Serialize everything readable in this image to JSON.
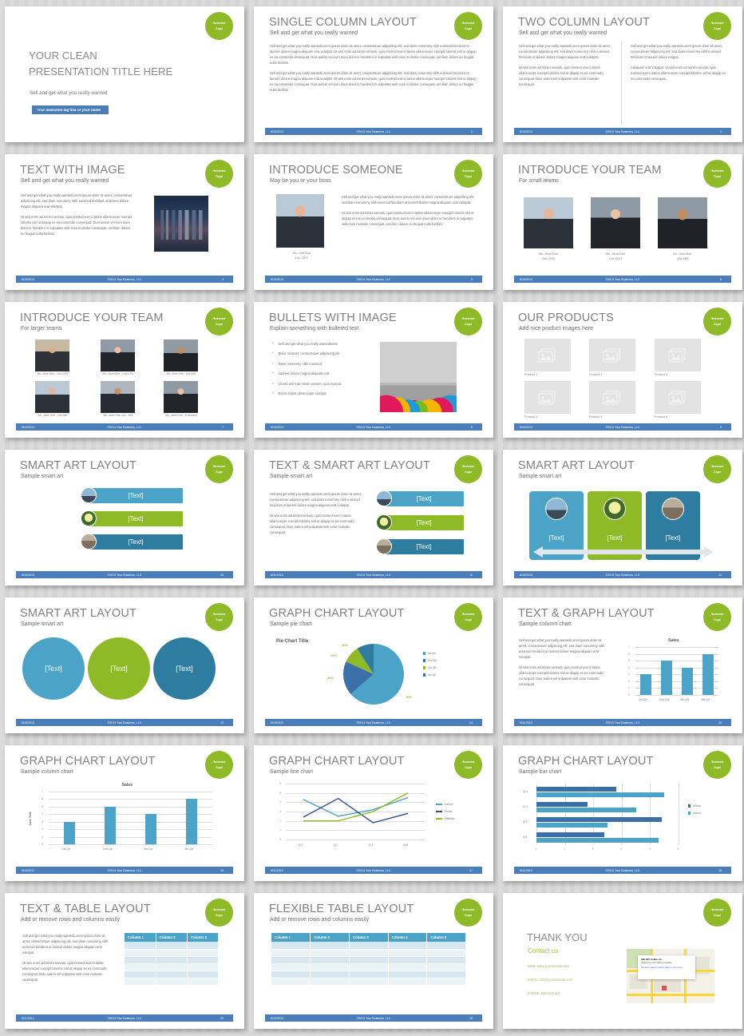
{
  "logo": {
    "line1": "Awesome",
    "line2": "Logo",
    "color": "#8fba28"
  },
  "footer_copy": "©2013 Your Business, LLC",
  "theme": {
    "blue": "#4a7ebb",
    "teal": "#4ba3c7",
    "green": "#8fba28",
    "dark_blue": "#2e6da4"
  },
  "lorem": {
    "p1": "Sell and get what you really wantedLorem ipsum dolor sit amet, consectetuer adipiscing elit, sed diam nonummy nibh euismod tincidunt ut laoreet dolore magna aliquam erat volutpat. Ut wisi enim ad minim veniam, quis nostrud exerci tation ullamcorper suscipit lobortis nisl ut aliquip ex ea commodo consequat. Duis autem vel eum iriure dolor in hendrerit in vulputate velit esse molestie consequat, vel illum dolore eu feugiat nulla facilisis.",
    "p2": "Sell and get what you really wantedLorem ipsum dolor sit amet, consectetuer adipiscing elit, sed diam nonummy nibh euismod tincidunt ut laoreet dolore magna aliquam erat volutpat. Ut wisi enim ad minim veniam, quis nostrud exerci tation ullamcorper suscipit lobortis nisl ut aliquip ex ea commodo consequat. Duis autem vel eum iriure dolor in hendrerit in vulputate velit esse molestie consequat, vel illum dolore eu feugiat nulla facilisis",
    "col_a1": "Sell and get what you really wantedLorem ipsum dolor sit amet, consectetuer adipiscing elit, sed diam nonummy nibh euismod tincidunt ut laoreet dolore magna aliquam erat volutpat.",
    "col_a2": "Ut wisi enim ad minim veniam, quis nostrud exerci tation ullamcorper suscipit lobortis nisl ut aliquip ex ea commodo consequat. Duis autem vel vulputate velit esse molestie consequat.",
    "col_b1": "Sell and get what you really wantedLorem ipsum dolor sit amet, consectetuer adipiscing elit, sed diam nonummy nibh euismod tincidunt ut laoreet dolore magna.",
    "col_b2": "Aaliquam erat volutpat. Ut wisi enim ad minim veniam, quis nostrud exerci tation ullamcorper suscipit lobortis nisl ut aliquip ex ea commodo consequat.",
    "img_p1": "Sell and get what you really wantedLorem ipsum dolor sit amet, consectetuer adipiscing elit, sed diam nonummy nibh euismod tincidunt ut laoreet dolore magna aliquam erat volutpat.",
    "img_p2": "Ut wisi enim ad minim veniam, quis nostrud exerci tation ullamcorper suscipit lobortis nisl ut aliquip ex ea commodo consequat. Duis autem vel eum iriure dolor in hendrerit in vulputate velit esse molestie consequat, vel illum dolore eu feugiat nulla facilisis",
    "someone_p1": "Sell and get what you really wantedLorem ipsum dolor sit amet, consectetuer adipiscing elit, sed diam nonummy nibh euismod tincidunt ut laoreet dolore magna aliquam erat volutpat.",
    "someone_p2": "Ut wisi enim ad minim veniam, quis nostrud exerci tation ullamcorper suscipit lobortis nisl ut aliquip ex ea commodo consequat. Duis autem vel eum iriure dolor in hendrerit in vulputate velit esse molestie consequat, vel illum dolore eu feugiat nulla facilisis",
    "sa_p1": "Sell and get what you really wantedLorem ipsum dolor sit amet, consectetuer adipiscing elit, sed diam nonummy nibh euismod tincidunt ut laoreet dolore magna aliquam erat volutpat.",
    "sa_p2": "Ut wisi enim ad minim veniam, quis nostrud exerci tation ullamcorper suscipit lobortis nisl ut aliquip ex ea commodo consequat. Duis autem vel vulputate velit esse molestie consequat."
  },
  "slides": [
    {
      "id": 1,
      "kind": "title",
      "title": "YOUR CLEAN PRESENTATION TITLE HERE",
      "subtitle": "Sell and get what you really wanted",
      "tagline": "Your awesome tag line or  your name"
    },
    {
      "id": 2,
      "kind": "single-column",
      "title": "SINGLE COLUMN LAYOUT",
      "subtitle": "Sell and get what you really wanted",
      "date": "6/10/2013",
      "page": "2"
    },
    {
      "id": 3,
      "kind": "two-column",
      "title": "TWO COLUMN LAYOUT",
      "subtitle": "Sell and get what you really wanted",
      "date": "6/10/2013",
      "page": "3"
    },
    {
      "id": 4,
      "kind": "text-image",
      "title": "TEXT WITH IMAGE",
      "subtitle": "Sell and get what you really wanted",
      "date": "6/10/2013",
      "page": "4"
    },
    {
      "id": 5,
      "kind": "introduce-someone",
      "title": "INTRODUCE SOMEONE",
      "subtitle": "May be you or your boss",
      "date": "6/10/2013",
      "page": "5",
      "person": {
        "name": "Ms. Joni Doe",
        "role": "Our CEO"
      }
    },
    {
      "id": 6,
      "kind": "team-small",
      "title": "INTRODUCE YOUR TEAM",
      "subtitle": "For small teams",
      "date": "6/10/2013",
      "page": "6",
      "members": [
        {
          "name": "Ms. Jane Doe",
          "role": "Our CEO"
        },
        {
          "name": "Ms. Jane Doe",
          "role": "Our COO"
        },
        {
          "name": "Mr. John Doe",
          "role": "Our MD"
        }
      ]
    },
    {
      "id": 7,
      "kind": "team-large",
      "title": "INTRODUCE YOUR TEAM",
      "subtitle": "For larger teams",
      "date": "6/10/2013",
      "page": "7",
      "members": [
        {
          "label": "Ms. Jane Doe - Our CEO"
        },
        {
          "label": "Ms. Jane Doe - Our CFO"
        },
        {
          "label": "Mr. John Doe - Our MD"
        },
        {
          "label": "Ms. Jane Doe - Our MD"
        },
        {
          "label": "Mr. Jane Doe Our - MD"
        },
        {
          "label": "Ms. Jane Doe - Executive"
        }
      ]
    },
    {
      "id": 8,
      "kind": "bullets-image",
      "title": "BULLETS WITH IMAGE",
      "subtitle": "Explain something with bulleted text",
      "date": "6/10/2013",
      "page": "8",
      "bullets": [
        "Sell and get what you really wantedlorem",
        "Dolor sit amet, consectetuer adipiscing elit",
        "Diam nonummy nibh euismod",
        "Laoreet dolore magna aliquam erat",
        "Ut wisi enim ad minim veniam, quis nostrud",
        "Exerci tation ullamcorper suscipit"
      ]
    },
    {
      "id": 9,
      "kind": "products",
      "title": "OUR PRODUCTS",
      "subtitle": "Add nice product images here",
      "date": "6/10/2013",
      "page": "9",
      "products": [
        "Product 1",
        "Product 2",
        "Product 3",
        "Product 4",
        "Prdduct 4",
        "Product 6"
      ]
    },
    {
      "id": 10,
      "kind": "smart-art-bars",
      "title": "SMART ART LAYOUT",
      "subtitle": "Sample smart art",
      "date": "6/10/2013",
      "page": "10",
      "items": [
        {
          "label": "[Text]",
          "color": "#4ba3c7",
          "icon": "penguin-icon"
        },
        {
          "label": "[Text]",
          "color": "#8fba28",
          "icon": "flower-icon"
        },
        {
          "label": "[Text]",
          "color": "#2e7ca0",
          "icon": "koala-icon"
        }
      ]
    },
    {
      "id": 11,
      "kind": "text-smart-art",
      "title": "TEXT & SMART ART LAYOUT",
      "subtitle": "Sample smart art",
      "date": "6/11/2013",
      "page": "11",
      "items": [
        {
          "label": "[Text]",
          "color": "#4ba3c7",
          "icon": "penguin-icon"
        },
        {
          "label": "[Text]",
          "color": "#8fba28",
          "icon": "flower-icon"
        },
        {
          "label": "[Text]",
          "color": "#2e7ca0",
          "icon": "koala-icon"
        }
      ]
    },
    {
      "id": 12,
      "kind": "smart-art-cards",
      "title": "SMART ART LAYOUT",
      "subtitle": "Sample smart art",
      "date": "6/10/2013",
      "page": "12",
      "items": [
        {
          "label": "[Text]",
          "color": "#4ba3c7",
          "icon": "penguin-icon"
        },
        {
          "label": "[Text]",
          "color": "#8fba28",
          "icon": "flower-icon"
        },
        {
          "label": "[Text]",
          "color": "#2e7ca0",
          "icon": "koala-icon"
        }
      ]
    },
    {
      "id": 13,
      "kind": "smart-art-circles",
      "title": "SMART ART LAYOUT",
      "subtitle": "Sample smart art",
      "date": "6/10/2013",
      "page": "13",
      "items": [
        {
          "label": "[Text]",
          "color": "#4ba3c7"
        },
        {
          "label": "[Text]",
          "color": "#8fba28"
        },
        {
          "label": "[Text]",
          "color": "#2e7ca0"
        }
      ]
    },
    {
      "id": 14,
      "kind": "pie",
      "title": "GRAPH CHART LAYOUT",
      "subtitle": "Sample pie chart",
      "date": "6/10/2013",
      "page": "14"
    },
    {
      "id": 15,
      "kind": "text-column-chart",
      "title": "TEXT & GRAPH LAYOUT",
      "subtitle": "Sample column chart",
      "date": "6/11/2013",
      "page": "15"
    },
    {
      "id": 16,
      "kind": "column-chart",
      "title": "GRAPH CHART LAYOUT",
      "subtitle": "Sample column chart",
      "date": "6/10/2013",
      "page": "16"
    },
    {
      "id": 17,
      "kind": "line-chart",
      "title": "GRAPH CHART LAYOUT",
      "subtitle": "Sample line chart",
      "date": "6/11/2013",
      "page": "17"
    },
    {
      "id": 18,
      "kind": "bar-chart",
      "title": "GRAPH CHART LAYOUT",
      "subtitle": "Sample bar chart",
      "date": "6/11/2013",
      "page": "18"
    },
    {
      "id": 20,
      "kind": "text-table",
      "title": "TEXT & TABLE LAYOUT",
      "subtitle": "Add or remove rows and columns easily",
      "date": "6/11/2013",
      "page": "20",
      "columns": [
        "Column 1",
        "Column 2",
        "Column 3"
      ],
      "rows": 6
    },
    {
      "id": 19,
      "kind": "flexible-table",
      "title": "FLEXIBLE TABLE LAYOUT",
      "subtitle": "Add or remove rows and columns easily",
      "date": "6/10/2013",
      "page": "19",
      "columns": [
        "Column 1",
        "Column 2",
        "Column 3",
        "Column 4",
        "Column 5"
      ],
      "rows": 6
    },
    {
      "id": 21,
      "kind": "thank-you",
      "title": "THANK YOU",
      "subtitle": "Contact us",
      "contact": {
        "web": "WEB: www.yourwebsite.com",
        "email": "EMAIL: info@yourwebsite.com",
        "phone": "PHONE: 625-625-123"
      },
      "map": {
        "place": "589-605 Collins St",
        "addr": "Melbourne VIC 3000, Australia",
        "links": "Directions   Search nearby   Save to map   more »"
      }
    }
  ],
  "chart_data": [
    {
      "type": "pie",
      "title": "Pie Chart Title",
      "categories": [
        "1st Qtr",
        "2nd Qtr",
        "3rd Qtr",
        "4th Qtr"
      ],
      "values": [
        70,
        20,
        10,
        10
      ],
      "labels": [
        "70%",
        "20%",
        "10%",
        "10%"
      ],
      "colors": [
        "#4ba3c7",
        "#3b6fa8",
        "#8fba28",
        "#2e7ca0"
      ],
      "legend_position": "right"
    },
    {
      "type": "bar",
      "title": "Sales",
      "categories": [
        "1st Qtr",
        "2nd Qtr",
        "3rd Qtr",
        "4th Qtr"
      ],
      "values": [
        3,
        5,
        4,
        6
      ],
      "ylim": [
        0,
        7
      ],
      "yticks": [
        "0",
        "1",
        "2",
        "3",
        "4",
        "5",
        "6",
        "7"
      ],
      "xlabel": "",
      "ylabel": "",
      "grid": true,
      "color": "#4ba3c7"
    },
    {
      "type": "bar",
      "title": "Sales",
      "categories": [
        "1st Qtr",
        "2nd Qtr",
        "3rd Qtr",
        "4th Qtr"
      ],
      "values": [
        3,
        5,
        4,
        6
      ],
      "ylim": [
        0,
        7
      ],
      "yticks": [
        "0",
        "1",
        "2",
        "3",
        "4",
        "5",
        "6",
        "7"
      ],
      "xlabel": "",
      "ylabel": "Axis Title",
      "grid": true,
      "color": "#4ba3c7"
    },
    {
      "type": "line",
      "title": "",
      "x": [
        "Q 1",
        "Q 2",
        "Q 3",
        "Q 4"
      ],
      "series": [
        {
          "name": "Instore",
          "values": [
            4.3,
            2.5,
            3.2,
            4.5
          ],
          "color": "#4ba3c7"
        },
        {
          "name": "Online",
          "values": [
            2.4,
            4.4,
            1.8,
            2.8
          ],
          "color": "#2d4f8a"
        },
        {
          "name": "Affiliates",
          "values": [
            2.0,
            2.0,
            3.0,
            5.0
          ],
          "color": "#8fba28"
        }
      ],
      "ylim": [
        0,
        6
      ],
      "yticks": [
        "0",
        "1",
        "2",
        "3",
        "4",
        "5",
        "6"
      ],
      "grid": true,
      "legend_position": "right"
    },
    {
      "type": "bar",
      "orientation": "horizontal",
      "title": "",
      "categories": [
        "Q 1",
        "Q 2",
        "Q 3",
        "Q 4"
      ],
      "series": [
        {
          "name": "Online",
          "values": [
            2.4,
            4.4,
            1.8,
            2.8
          ],
          "color": "#3b6fa8"
        },
        {
          "name": "Instore",
          "values": [
            4.3,
            2.5,
            3.5,
            4.5
          ],
          "color": "#4ba3c7"
        }
      ],
      "xlim": [
        0,
        5
      ],
      "xticks": [
        "0",
        "1",
        "2",
        "3",
        "4",
        "5"
      ],
      "grid": true,
      "legend_position": "right"
    }
  ]
}
